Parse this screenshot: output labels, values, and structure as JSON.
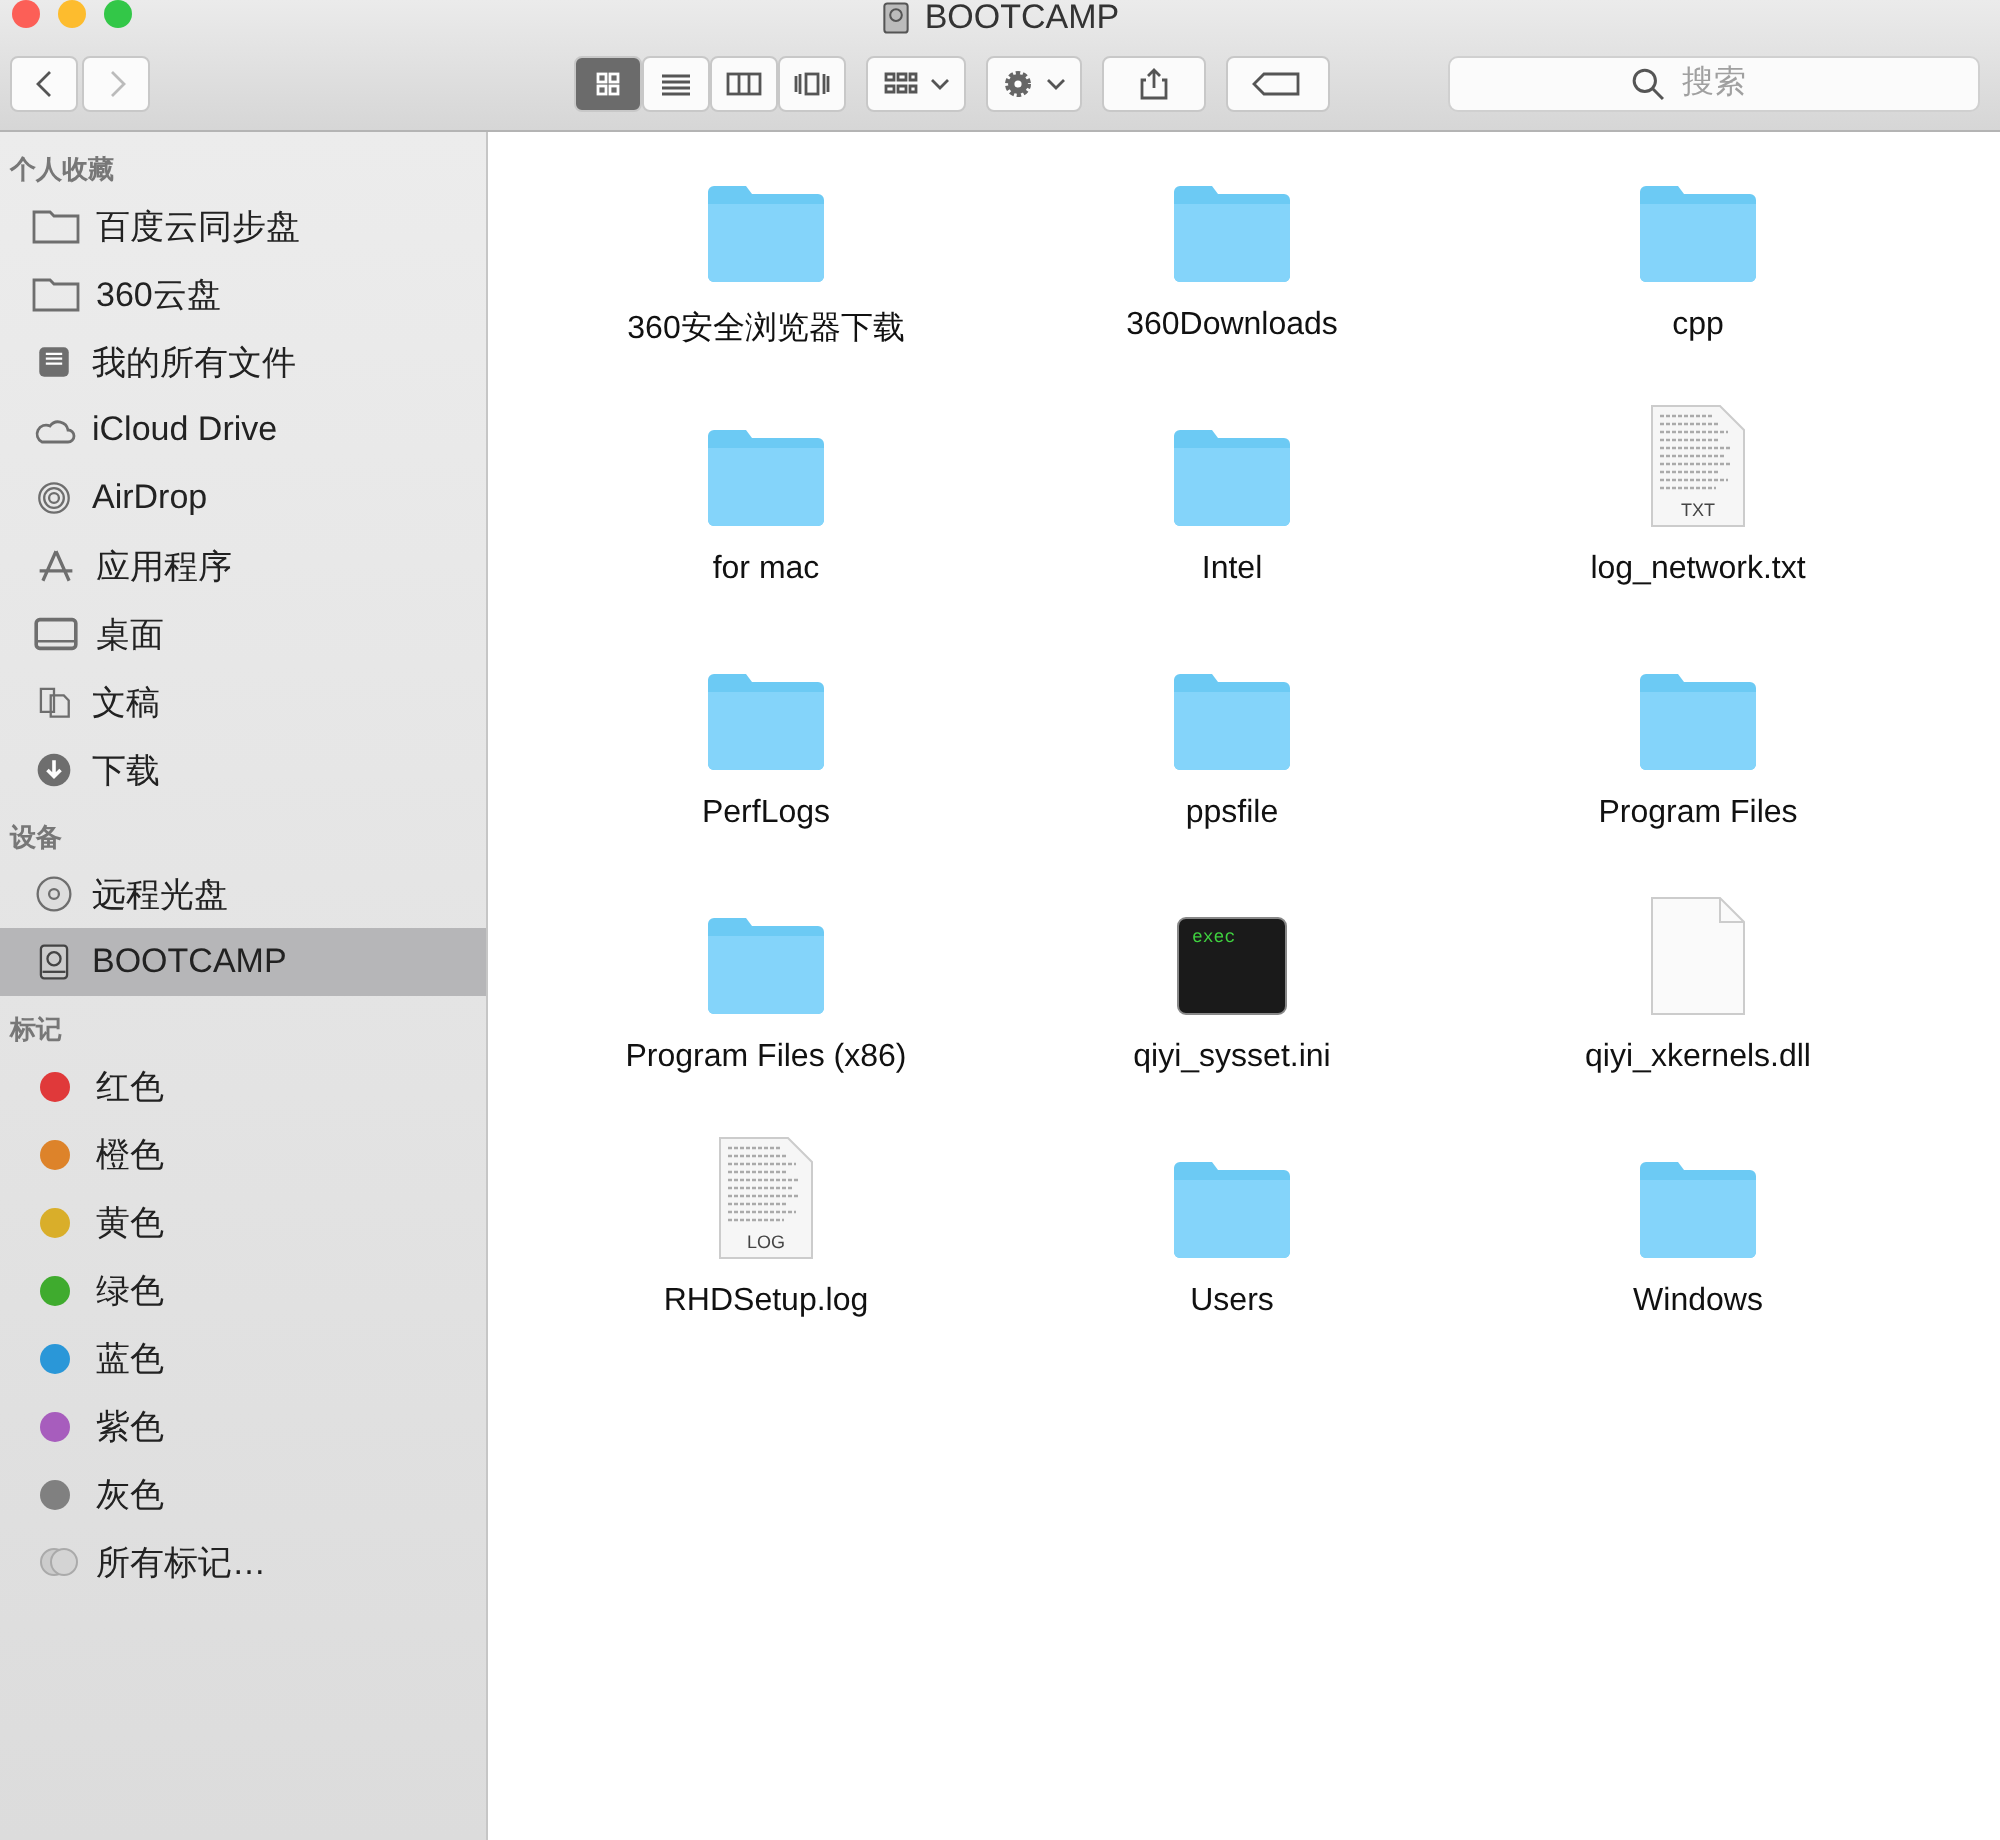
{
  "window": {
    "title": "BOOTCAMP"
  },
  "toolbar": {
    "nav": [
      {
        "kind": "back",
        "disabled": false
      },
      {
        "kind": "forward",
        "disabled": true
      }
    ],
    "views": [
      {
        "kind": "icons",
        "selected": true
      },
      {
        "kind": "list",
        "selected": false
      },
      {
        "kind": "columns",
        "selected": false
      },
      {
        "kind": "coverflow",
        "selected": false
      }
    ],
    "actions": [
      {
        "kind": "arrange"
      },
      {
        "kind": "gear"
      },
      {
        "kind": "share"
      },
      {
        "kind": "tag"
      }
    ],
    "search": {
      "placeholder": "搜索"
    }
  },
  "sidebar": {
    "sections": [
      {
        "heading": "个人收藏",
        "items": [
          {
            "kind": "folder",
            "label": "百度云同步盘",
            "selected": false
          },
          {
            "kind": "folder",
            "label": "360云盘",
            "selected": false
          },
          {
            "kind": "allfiles",
            "label": "我的所有文件",
            "selected": false
          },
          {
            "kind": "cloud",
            "label": "iCloud Drive",
            "selected": false
          },
          {
            "kind": "airdrop",
            "label": "AirDrop",
            "selected": false
          },
          {
            "kind": "apps",
            "label": "应用程序",
            "selected": false
          },
          {
            "kind": "desktop",
            "label": "桌面",
            "selected": false
          },
          {
            "kind": "documents",
            "label": "文稿",
            "selected": false
          },
          {
            "kind": "downloads",
            "label": "下载",
            "selected": false
          }
        ]
      },
      {
        "heading": "设备",
        "items": [
          {
            "kind": "disc",
            "label": "远程光盘",
            "selected": false
          },
          {
            "kind": "drive",
            "label": "BOOTCAMP",
            "selected": true
          }
        ]
      },
      {
        "heading": "标记",
        "items": [
          {
            "kind": "tag",
            "label": "红色",
            "color": "#e0393a",
            "selected": false
          },
          {
            "kind": "tag",
            "label": "橙色",
            "color": "#dd832a",
            "selected": false
          },
          {
            "kind": "tag",
            "label": "黄色",
            "color": "#d9ae2a",
            "selected": false
          },
          {
            "kind": "tag",
            "label": "绿色",
            "color": "#3fab2e",
            "selected": false
          },
          {
            "kind": "tag",
            "label": "蓝色",
            "color": "#2a97d8",
            "selected": false
          },
          {
            "kind": "tag",
            "label": "紫色",
            "color": "#a75dbd",
            "selected": false
          },
          {
            "kind": "tag",
            "label": "灰色",
            "color": "#808080",
            "selected": false
          },
          {
            "kind": "alltags",
            "label": "所有标记…",
            "selected": false
          }
        ]
      }
    ]
  },
  "files": [
    {
      "kind": "folder",
      "name": "360安全浏览器下载"
    },
    {
      "kind": "folder",
      "name": "360Downloads"
    },
    {
      "kind": "folder",
      "name": "cpp"
    },
    {
      "kind": "folder",
      "name": "for mac"
    },
    {
      "kind": "folder",
      "name": "Intel"
    },
    {
      "kind": "text",
      "name": "log_network.txt",
      "badge": "TXT"
    },
    {
      "kind": "folder",
      "name": "PerfLogs"
    },
    {
      "kind": "folder",
      "name": "ppsfile"
    },
    {
      "kind": "folder",
      "name": "Program Files"
    },
    {
      "kind": "folder",
      "name": "Program Files (x86)"
    },
    {
      "kind": "exec",
      "name": "qiyi_sysset.ini",
      "badge": "exec"
    },
    {
      "kind": "blank",
      "name": "qiyi_xkernels.dll"
    },
    {
      "kind": "text",
      "name": "RHDSetup.log",
      "badge": "LOG"
    },
    {
      "kind": "folder",
      "name": "Users"
    },
    {
      "kind": "folder",
      "name": "Windows"
    }
  ]
}
